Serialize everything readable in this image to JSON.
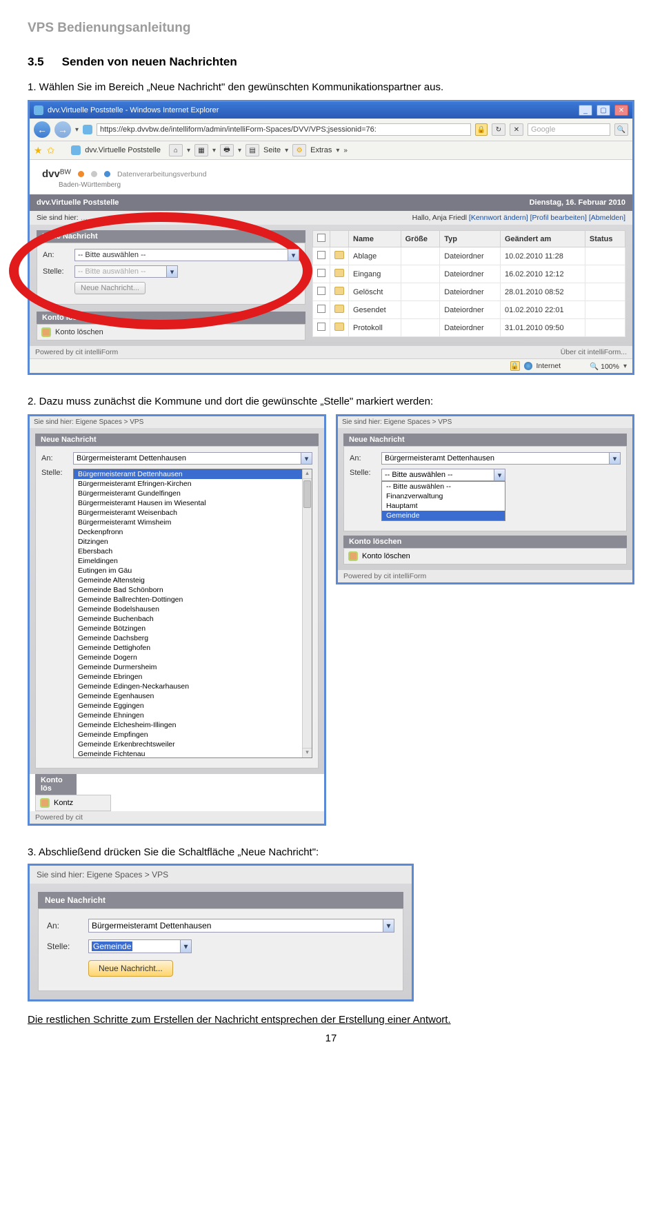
{
  "doc_title": "VPS Bedienungsanleitung",
  "section_num": "3.5",
  "section_title": "Senden von neuen Nachrichten",
  "step1": "1. Wählen Sie im Bereich „Neue Nachricht\" den gewünschten Kommunikationspartner aus.",
  "step2": "2. Dazu muss zunächst die Kommune und dort die gewünschte „Stelle\" markiert werden:",
  "step3": "3. Abschließend drücken Sie die Schaltfläche „Neue Nachricht\":",
  "footer_text": "Die restlichen Schritte zum Erstellen der Nachricht entsprechen der Erstellung einer Antwort.",
  "page_number": "17",
  "ie": {
    "title": "dvv.Virtuelle Poststelle - Windows Internet Explorer",
    "url": "https://ekp.dvvbw.de/intelliform/admin/intelliForm-Spaces/DVV/VPS;jsessionid=76:",
    "search_engine": "Google",
    "fav_tab": "dvv.Virtuelle Poststelle",
    "toolbar_seite": "Seite",
    "toolbar_extras": "Extras"
  },
  "app": {
    "logo": "dvv",
    "logo_sup": "BW",
    "logo_sub1": "Datenverarbeitungsverbund",
    "logo_sub2": "Baden-Württemberg",
    "darkbar_left": "dvv.Virtuelle Poststelle",
    "darkbar_right": "Dienstag, 16. Februar 2010",
    "greybar_left": "Sie sind hier:",
    "greybar_right_pre": "Hallo, Anja Friedl ",
    "link_pw": "[Kennwort ändern]",
    "link_profile": "[Profil bearbeiten]",
    "link_logout": "[Abmelden]",
    "panel_new": "Neue Nachricht",
    "lbl_an": "An:",
    "lbl_stelle": "Stelle:",
    "sel_placeholder": "-- Bitte auswählen --",
    "btn_new": "Neue Nachricht...",
    "panel_del": "Konto löschen",
    "link_del": "Konto löschen",
    "th_name": "Name",
    "th_size": "Größe",
    "th_type": "Typ",
    "th_mod": "Geändert am",
    "th_status": "Status",
    "rows": [
      {
        "name": "Ablage",
        "type": "Dateiordner",
        "mod": "10.02.2010 11:28"
      },
      {
        "name": "Eingang",
        "type": "Dateiordner",
        "mod": "16.02.2010 12:12"
      },
      {
        "name": "Gelöscht",
        "type": "Dateiordner",
        "mod": "28.01.2010 08:52"
      },
      {
        "name": "Gesendet",
        "type": "Dateiordner",
        "mod": "01.02.2010 22:01"
      },
      {
        "name": "Protokoll",
        "type": "Dateiordner",
        "mod": "31.01.2010 09:50"
      }
    ],
    "powered": "Powered by cit intelliForm",
    "about": "Über cit intelliForm...",
    "status_internet": "Internet",
    "status_zoom": "100%"
  },
  "shot2": {
    "crumb": "Sie sind hier: Eigene Spaces > VPS",
    "sel_an": "Bürgermeisteramt Dettenhausen",
    "left_hl": "Bürgermeisteramt Dettenhausen",
    "left_opts": [
      "Bürgermeisteramt Efringen-Kirchen",
      "Bürgermeisteramt Gundelfingen",
      "Bürgermeisteramt Hausen im Wiesental",
      "Bürgermeisteramt Weisenbach",
      "Bürgermeisteramt Wimsheim",
      "Deckenpfronn",
      "Ditzingen",
      "Ebersbach",
      "Eimeldingen",
      "Eutingen im Gäu",
      "Gemeinde Altensteig",
      "Gemeinde Bad Schönborn",
      "Gemeinde Ballrechten-Dottingen",
      "Gemeinde Bodelshausen",
      "Gemeinde Buchenbach",
      "Gemeinde Bötzingen",
      "Gemeinde Dachsberg",
      "Gemeinde Dettighofen",
      "Gemeinde Dogern",
      "Gemeinde Durmersheim",
      "Gemeinde Ebringen",
      "Gemeinde Edingen-Neckarhausen",
      "Gemeinde Egenhausen",
      "Gemeinde Eggingen",
      "Gemeinde Ehningen",
      "Gemeinde Elchesheim-Illingen",
      "Gemeinde Empfingen",
      "Gemeinde Erkenbrechtsweiler",
      "Gemeinde Fichtenau"
    ],
    "right_sel_value": "-- Bitte auswählen --",
    "right_opts_pre": [
      "-- Bitte auswählen --",
      "Finanzverwaltung",
      "Hauptamt"
    ],
    "right_hl": "Gemeinde",
    "kontz": "Kontz",
    "powered": "Powered by cit",
    "powered2": "Powered by cit intelliForm"
  },
  "shot3": {
    "crumb": "Sie sind hier: Eigene Spaces > VPS",
    "an_val": "Bürgermeisteramt Dettenhausen",
    "stelle_val": "Gemeinde",
    "btn": "Neue Nachricht..."
  }
}
